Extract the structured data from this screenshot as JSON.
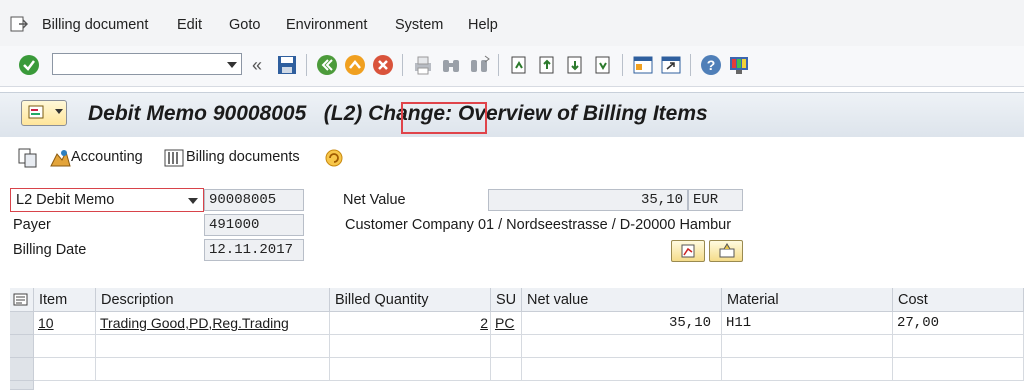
{
  "menubar": {
    "items": [
      "Billing document",
      "Edit",
      "Goto",
      "Environment",
      "System",
      "Help"
    ]
  },
  "toolbar": {
    "command_field_value": "",
    "icons": [
      "enter-icon",
      "back-history-icon",
      "save-icon",
      "back-icon",
      "exit-icon",
      "cancel-icon",
      "print-icon",
      "find-icon",
      "find-next-icon",
      "first-page-icon",
      "previous-page-icon",
      "next-page-icon",
      "last-page-icon",
      "create-session-icon",
      "shortcut-icon",
      "help-icon",
      "layout-icon"
    ]
  },
  "title": {
    "text": "Debit Memo 90008005   (L2) Change: Overview of Billing Items"
  },
  "app_toolbar": {
    "accounting_label": "Accounting",
    "billing_documents_label": "Billing documents"
  },
  "header": {
    "doc_type_value": "L2 Debit Memo",
    "doc_number": "90008005",
    "payer_label": "Payer",
    "payer_value": "491000",
    "billing_date_label": "Billing Date",
    "billing_date_value": "12.11.2017",
    "net_value_label": "Net Value",
    "net_value": "35,10",
    "currency": "EUR",
    "payer_address": "Customer Company 01 / Nordseestrasse / D-20000 Hambur"
  },
  "table": {
    "columns": [
      "Item",
      "Description",
      "Billed Quantity",
      "SU",
      "Net value",
      "Material",
      "Cost"
    ],
    "rows": [
      {
        "item": "10",
        "description": "Trading Good,PD,Reg.Trading",
        "qty": "2",
        "su": "PC",
        "net_value": "35,10",
        "material": "H11",
        "cost": "27,00"
      }
    ]
  },
  "colors": {
    "accent_green": "#3a9a3a",
    "highlight_red": "#e0444a",
    "title_bar": "#dde4ec"
  }
}
